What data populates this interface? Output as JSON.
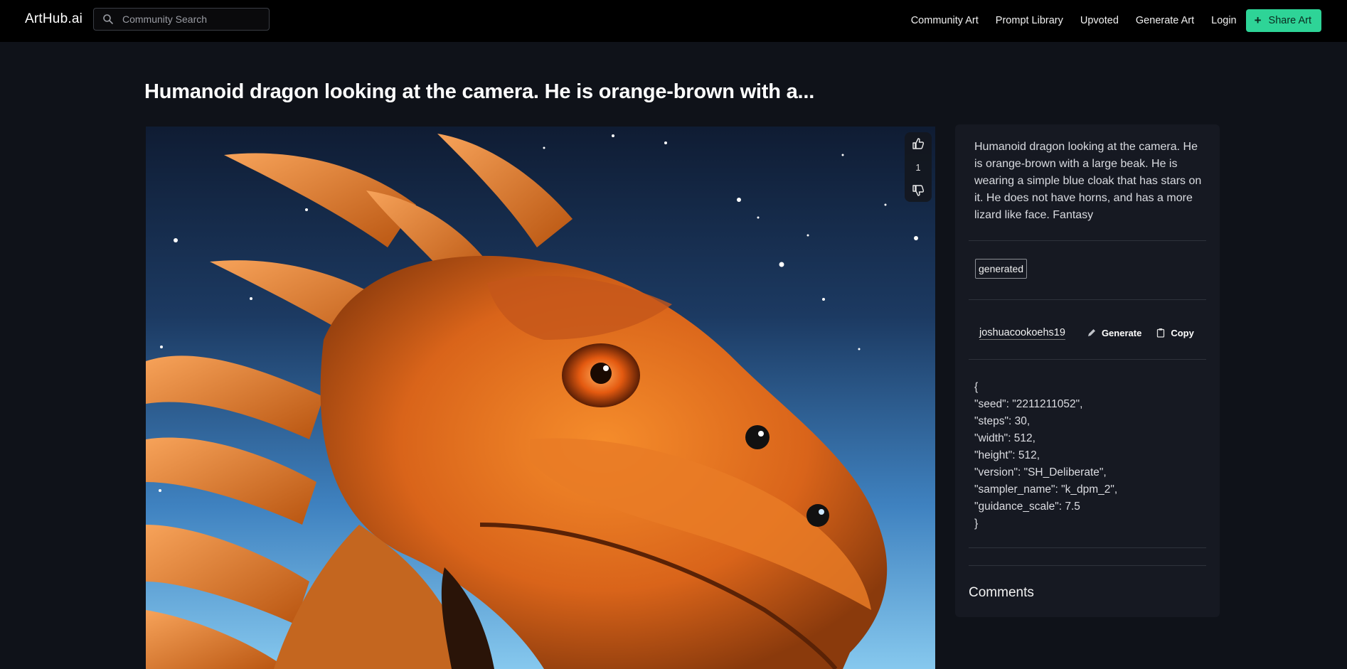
{
  "nav": {
    "logo": "ArtHub.ai",
    "search_placeholder": "Community Search",
    "links": [
      "Community Art",
      "Prompt Library",
      "Upvoted",
      "Generate Art",
      "Login"
    ],
    "share_label": "Share Art",
    "share_color": "#2ed497"
  },
  "page": {
    "title": "Humanoid dragon looking at the camera. He is orange-brown with a..."
  },
  "votes": {
    "count": "1",
    "up_icon": "thumbs-up-icon",
    "down_icon": "thumbs-down-icon"
  },
  "panel": {
    "prompt": "Humanoid dragon looking at the camera. He is orange-brown with a large beak. He is wearing a simple blue cloak that has stars on it. He does not have horns, and has a more lizard like face. Fantasy",
    "tag": "generated",
    "username": "joshuacookoehs19",
    "generate_label": "Generate",
    "copy_label": "Copy",
    "params": "{\n\"seed\": \"2211211052\",\n\"steps\": 30,\n\"width\": 512,\n\"height\": 512,\n\"version\": \"SH_Deliberate\",\n\"sampler_name\": \"k_dpm_2\",\n\"guidance_scale\": 7.5\n}",
    "comments_heading": "Comments"
  }
}
